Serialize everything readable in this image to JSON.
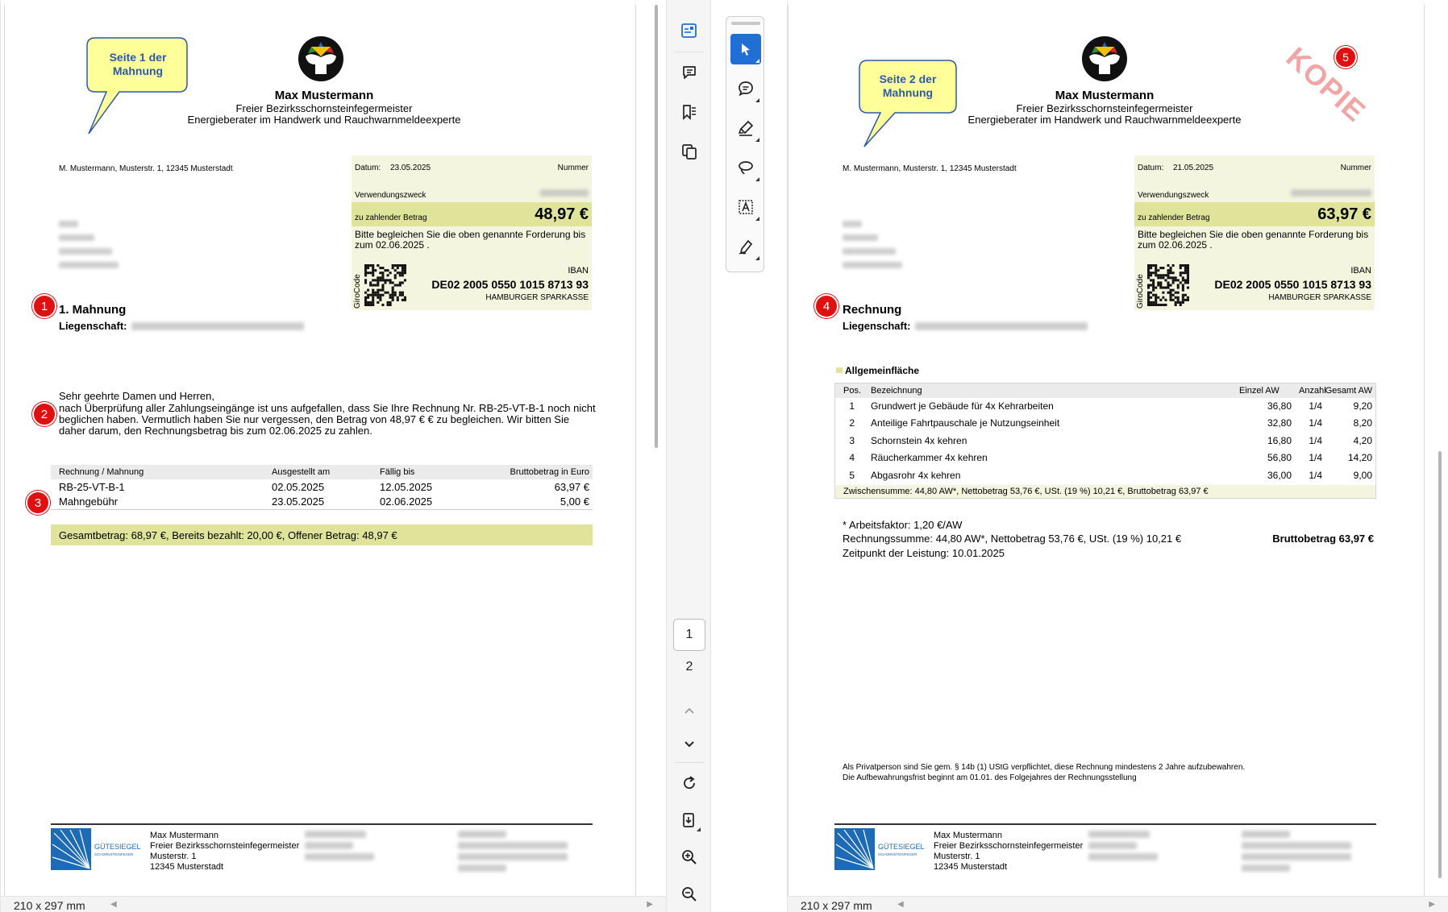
{
  "colors": {
    "info_box_bg": "#f4f5df",
    "amount_band": "#dfe49a",
    "badge_red": "#e10f0f",
    "callout_fill": "#ffff9a",
    "callout_text": "#2d5aa8",
    "active_tool": "#1f6fd6",
    "kopie_watermark": "#f1a6a6"
  },
  "left_page": {
    "callout": "Seite 1 der Mahnung",
    "sender": {
      "name": "Max Mustermann",
      "line1": "Freier Bezirksschornsteinfegermeister",
      "line2": "Energieberater im Handwerk und Rauchwarnmeldeexperte"
    },
    "return_address": "M. Mustermann, Musterstr. 1, 12345 Musterstadt",
    "info": {
      "datum_label": "Datum:",
      "datum": "23.05.2025",
      "nummer_label": "Nummer",
      "verwendungszweck_label": "Verwendungszweck",
      "amount_label": "zu zahlender Betrag",
      "amount": "48,97 €",
      "pay_note": "Bitte begleichen Sie die oben genannte Forderung bis zum 02.06.2025 .",
      "girocode_label": "GiroCode",
      "iban_label": "IBAN",
      "iban": "DE02 2005 0550 1015 8713 93",
      "bank": "HAMBURGER SPARKASSE"
    },
    "badges": [
      "1",
      "2",
      "3"
    ],
    "title": "1. Mahnung",
    "property_label": "Liegenschaft:",
    "greeting": "Sehr geehrte Damen und Herren,",
    "body": "nach Überprüfung aller Zahlungseingänge ist uns aufgefallen, dass Sie Ihre Rechnung Nr. RB-25-VT-B-1 noch nicht beglichen haben. Vermutlich haben Sie nur vergessen, den Betrag von 48,97 € € zu begleichen. Wir bitten Sie daher darum, den Rechnungsbetrag bis zum 02.06.2025 zu zahlen.",
    "table": {
      "headers": [
        "Rechnung / Mahnung",
        "Ausgestellt am",
        "Fällig bis",
        "Bruttobetrag in Euro"
      ],
      "rows": [
        [
          "RB-25-VT-B-1",
          "02.05.2025",
          "12.05.2025",
          "63,97 €"
        ],
        [
          "Mahngebühr",
          "23.05.2025",
          "02.06.2025",
          "5,00 €"
        ]
      ]
    },
    "total": "Gesamtbetrag: 68,97 €, Bereits bezahlt: 20,00 €, Offener Betrag: 48,97 €",
    "footer": {
      "seal_title": "GÜTESIEGEL",
      "seal_sub": "SCHORNSTEINFEGER",
      "lines": [
        "Max Mustermann",
        "Freier Bezirksschornsteinfegermeister",
        "Musterstr. 1",
        "12345 Musterstadt"
      ]
    },
    "page_size": "210 x 297 mm"
  },
  "right_page": {
    "callout": "Seite 2 der Mahnung",
    "watermark": "KOPIE",
    "sender": {
      "name": "Max Mustermann",
      "line1": "Freier Bezirksschornsteinfegermeister",
      "line2": "Energieberater im Handwerk und Rauchwarnmeldeexperte"
    },
    "return_address": "M. Mustermann, Musterstr. 1, 12345 Musterstadt",
    "info": {
      "datum_label": "Datum:",
      "datum": "21.05.2025",
      "nummer_label": "Nummer",
      "verwendungszweck_label": "Verwendungszweck",
      "amount_label": "zu zahlender Betrag",
      "amount": "63,97 €",
      "pay_note": "Bitte begleichen Sie die oben genannte Forderung bis zum 02.06.2025 .",
      "girocode_label": "GiroCode",
      "iban_label": "IBAN",
      "iban": "DE02 2005 0550 1015 8713 93",
      "bank": "HAMBURGER SPARKASSE"
    },
    "badges": [
      "4",
      "5"
    ],
    "title": "Rechnung",
    "property_label": "Liegenschaft:",
    "section": "Allgemeinfläche",
    "table": {
      "headers": [
        "Pos.",
        "Bezeichnung",
        "Einzel AW",
        "Anzahl",
        "Gesamt AW"
      ],
      "rows": [
        [
          "1",
          "Grundwert je Gebäude für 4x Kehrarbeiten",
          "36,80",
          "1/4",
          "9,20"
        ],
        [
          "2",
          "Anteilige Fahrtpauschale je Nutzungseinheit",
          "32,80",
          "1/4",
          "8,20"
        ],
        [
          "3",
          "Schornstein 4x kehren",
          "16,80",
          "1/4",
          "4,20"
        ],
        [
          "4",
          "Räucherkammer 4x kehren",
          "56,80",
          "1/4",
          "14,20"
        ],
        [
          "5",
          "Abgasrohr 4x kehren",
          "36,00",
          "1/4",
          "9,00"
        ]
      ],
      "subtotal": "Zwischensumme: 44,80 AW*, Nettobetrag 53,76 €, USt. (19 %) 10,21 €, Bruttobetrag 63,97 €"
    },
    "arbeitsfaktor": "* Arbeitsfaktor: 1,20 €/AW",
    "rechnungssumme": "Rechnungssumme: 44,80 AW*, Nettobetrag 53,76 €, USt. (19 %) 10,21 €",
    "brutto": "Bruttobetrag 63,97 €",
    "leistung": "Zeitpunkt der Leistung: 10.01.2025",
    "hint_line1": "Als Privatperson sind Sie gem. § 14b (1) UStG verpflichtet, diese Rechnung mindestens 2 Jahre aufzubewahren.",
    "hint_line2": "Die Aufbewahrungsfrist beginnt am 01.01. des Folgejahres der Rechnungsstellung",
    "footer": {
      "seal_title": "GÜTESIEGEL",
      "seal_sub": "SCHORNSTEINFEGER",
      "lines": [
        "Max Mustermann",
        "Freier Bezirksschornsteinfegermeister",
        "Musterstr. 1",
        "12345 Musterstadt"
      ]
    },
    "page_size": "210 x 297 mm"
  },
  "toolbar": {
    "pages": [
      "1",
      "2"
    ],
    "icons": [
      "thumbnails-icon",
      "comments-icon",
      "bookmarks-icon",
      "copy-pages-icon",
      "chevron-up-icon",
      "chevron-down-icon",
      "rotate-icon",
      "export-icon",
      "zoom-in-icon",
      "zoom-out-icon"
    ]
  },
  "annotation_toolbar": {
    "icons": [
      "select-arrow-icon",
      "comment-icon",
      "highlighter-icon",
      "lasso-icon",
      "text-box-icon",
      "signature-pen-icon"
    ]
  }
}
